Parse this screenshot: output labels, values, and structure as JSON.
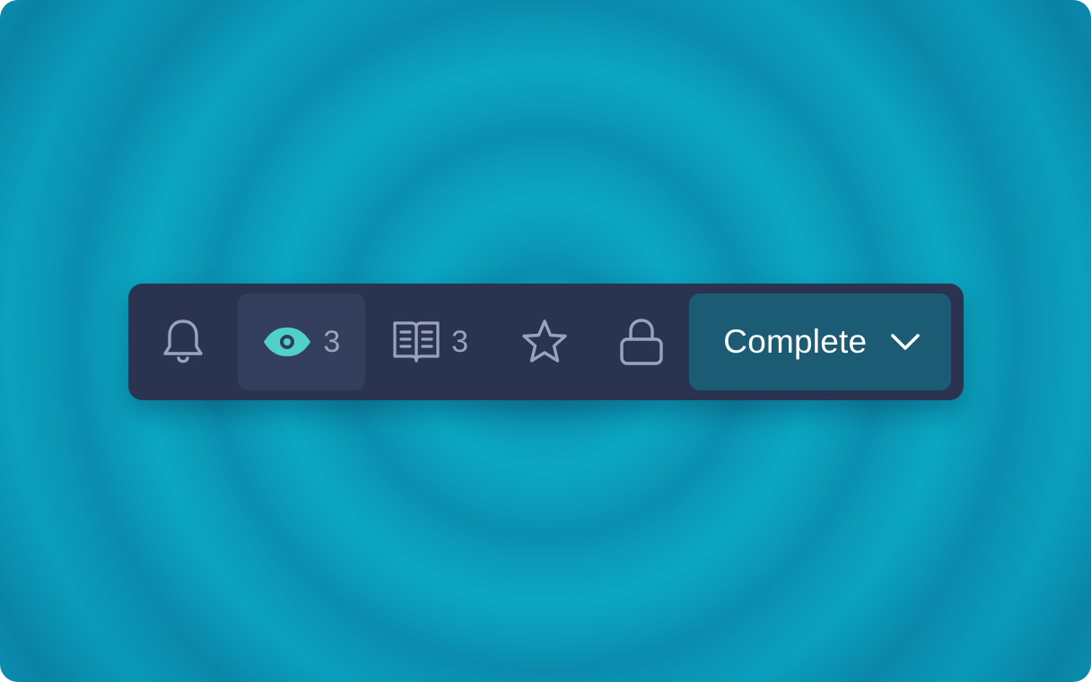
{
  "toolbar": {
    "buttons": [
      {
        "id": "notifications",
        "icon": "bell-icon"
      },
      {
        "id": "watch",
        "icon": "eye-icon",
        "count": "3",
        "selected": true,
        "accent": "#4fd1c9"
      },
      {
        "id": "read",
        "icon": "book-icon",
        "count": "3"
      },
      {
        "id": "favorite",
        "icon": "star-icon"
      },
      {
        "id": "lock",
        "icon": "lock-icon"
      }
    ],
    "status": {
      "label": "Complete",
      "icon": "chevron-down-icon"
    }
  },
  "colors": {
    "background": "#0aa7c3",
    "toolbar": "#2a3451",
    "selected_button": "#333f5d",
    "status_button": "#1b5b73",
    "icon_default": "#9aa3be",
    "icon_active": "#4fd1c9"
  }
}
